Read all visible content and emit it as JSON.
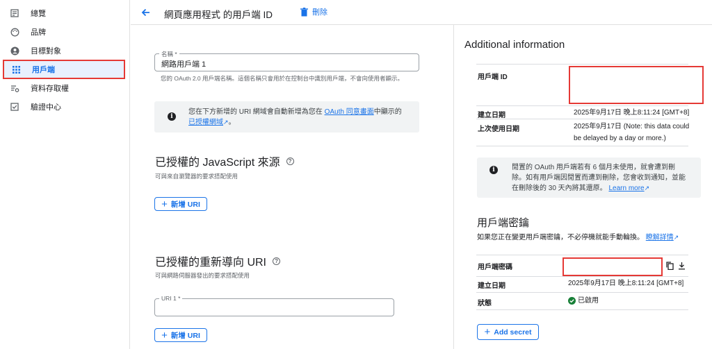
{
  "sidebar": {
    "items": [
      {
        "label": "總覽",
        "icon": "dashboard-icon"
      },
      {
        "label": "品牌",
        "icon": "palette-icon"
      },
      {
        "label": "目標對象",
        "icon": "person-circle-icon"
      },
      {
        "label": "用戶端",
        "icon": "grid-icon"
      },
      {
        "label": "資料存取權",
        "icon": "data-access-icon"
      },
      {
        "label": "驗證中心",
        "icon": "verified-checkbox-icon"
      }
    ]
  },
  "header": {
    "title": "網頁應用程式 的用戶端 ID",
    "delete_label": "刪除"
  },
  "form": {
    "name_label": "名稱 *",
    "name_value": "網路用戶端 1",
    "name_hint": "您的 OAuth 2.0 用戶端名稱。這個名稱只會用於在控制台中識別用戶端，不會向使用者顯示。",
    "info_prefix": "您在下方新增的 URI 網域會自動新增為您在",
    "info_link1": "OAuth 同意畫面",
    "info_mid": "中顯示的",
    "info_link2": "已授權網域",
    "info_suffix": "。",
    "js_title": "已授權的 JavaScript 來源",
    "js_hint": "可與來自瀏覽器的要求搭配使用",
    "add_uri_label": "新增 URI",
    "redirect_title": "已授權的重新導向 URI",
    "redirect_hint": "可與網路伺服器發出的要求搭配使用",
    "uri1_label": "URI 1 *",
    "add_uri_label2": "新增 URI"
  },
  "info": {
    "title": "Additional information",
    "client_id_label": "用戶端 ID",
    "created_label": "建立日期",
    "created_value": "2025年9月17日 晚上8:11:24 [GMT+8]",
    "last_used_label": "上次使用日期",
    "last_used_value1": "2025年9月17日 (Note: this data could",
    "last_used_value2": "be delayed by a day or more.)",
    "notice1": "閒置的 OAuth 用戶端若有 6 個月未使用，就會遭到刪",
    "notice2": "除。如有用戶端因閒置而遭到刪除，您會收到通知，並能",
    "notice3": "在刪除後的 30 天內將其還原。",
    "notice_link": "Learn more"
  },
  "secret": {
    "title": "用戶端密鑰",
    "desc": "如果您正在變更用戶端密鑰，不必停機就能手動輪換。",
    "desc_link": "瞭解詳情",
    "secret_label": "用戶端密碼",
    "created_label": "建立日期",
    "created_value": "2025年9月17日 晚上8:11:24 [GMT+8]",
    "status_label": "狀態",
    "status_value": "已啟用",
    "add_secret_label": "Add secret"
  },
  "colors": {
    "accent": "#1a73e8",
    "highlight_border": "#e53935",
    "success": "#188038"
  }
}
